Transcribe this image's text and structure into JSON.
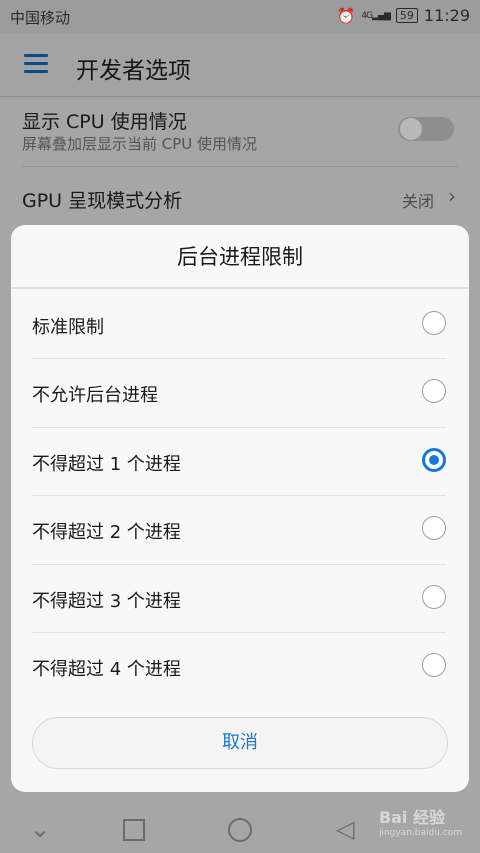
{
  "status_bar": {
    "carrier": "中国移动",
    "alarm_icon": "alarm-icon",
    "signal_label": "4G",
    "battery": "59",
    "time": "11:29"
  },
  "app_bar": {
    "menu_icon": "hamburger-menu-icon",
    "title": "开发者选项"
  },
  "settings": {
    "cpu": {
      "title": "显示 CPU 使用情况",
      "subtitle": "屏幕叠加层显示当前 CPU 使用情况",
      "toggle_on": false
    },
    "gpu": {
      "title": "GPU 呈现模式分析",
      "value": "关闭"
    }
  },
  "dialog": {
    "title": "后台进程限制",
    "options": [
      {
        "label": "标准限制",
        "selected": false
      },
      {
        "label": "不允许后台进程",
        "selected": false
      },
      {
        "label": "不得超过 1 个进程",
        "selected": true
      },
      {
        "label": "不得超过 2 个进程",
        "selected": false
      },
      {
        "label": "不得超过 3 个进程",
        "selected": false
      },
      {
        "label": "不得超过 4 个进程",
        "selected": false
      }
    ],
    "cancel_label": "取消"
  },
  "watermark": {
    "brand": "Bai 经验",
    "url": "jingyan.baidu.com"
  },
  "colors": {
    "accent": "#1478d4",
    "dim_overlay": "#a6a6a6"
  }
}
